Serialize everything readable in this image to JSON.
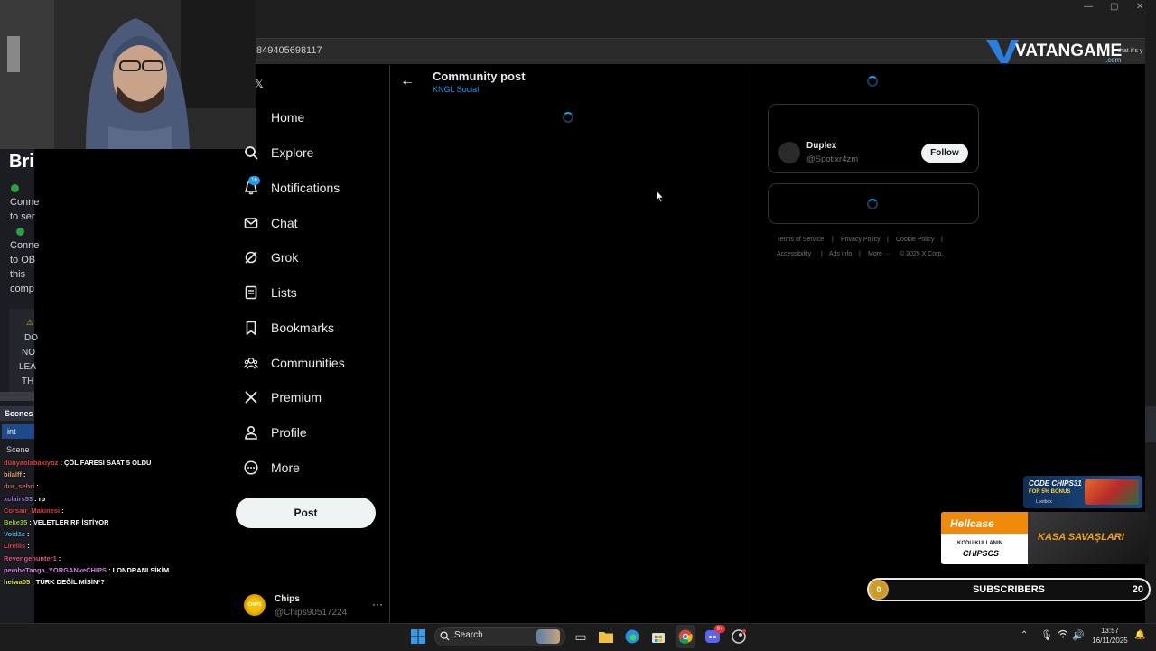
{
  "browser": {
    "address_text": "849405698117"
  },
  "overlay": {
    "brand_logo": "VATANGAME",
    "brand_sub": ".com",
    "brand_tail": "that it's y"
  },
  "obs": {
    "title_fragment": "Bri",
    "status_lines": [
      {
        "line1": "Conne",
        "line2": "to ser"
      },
      {
        "line1": "Conne",
        "line2": "to OB",
        "line3": "this",
        "line4": "comp"
      }
    ],
    "warning_lines": [
      "DO",
      "NO",
      "LEA",
      "TH"
    ],
    "scenes_header": "Scenes",
    "scene_selected": "int",
    "scene_label": "Scene"
  },
  "chat": [
    {
      "user": "dünyaolabakiyoz",
      "user_color": "#e04040",
      "msg": ": ÇÖL FARESİ SAAT 5 OLDU"
    },
    {
      "user": "bilalff",
      "user_color": "#d6a36b",
      "msg": ":"
    },
    {
      "user": "dur_sehri",
      "user_color": "#c06060",
      "msg": ":"
    },
    {
      "user": "xclairs53",
      "user_color": "#a070d0",
      "msg": ": rp"
    },
    {
      "user": "Corsair_Makinesi",
      "user_color": "#e04040",
      "msg": ":"
    },
    {
      "user": "Beke35",
      "user_color": "#9acd32",
      "msg": ": VELETLER RP İSTİYOR"
    },
    {
      "user": "Void1s",
      "user_color": "#4ab0e0",
      "msg": ":"
    },
    {
      "user": "Lirellis",
      "user_color": "#e04060",
      "msg": ":"
    },
    {
      "user": "Revengehunter1",
      "user_color": "#e0508a",
      "msg": ":"
    },
    {
      "user": "pembeTanga_YORGANveCHIPS",
      "user_color": "#d080e0",
      "msg": ": LONDRANI SİKİM"
    },
    {
      "user": "heiwa05",
      "user_color": "#e0e050",
      "msg": ": TÜRK DEĞİL MİSİN*?"
    }
  ],
  "sidebar": {
    "items": [
      {
        "label": "Home",
        "icon": "home-icon"
      },
      {
        "label": "Explore",
        "icon": "search-icon"
      },
      {
        "label": "Notifications",
        "icon": "bell-icon",
        "badge": "16"
      },
      {
        "label": "Chat",
        "icon": "mail-icon"
      },
      {
        "label": "Grok",
        "icon": "grok-icon"
      },
      {
        "label": "Lists",
        "icon": "list-icon"
      },
      {
        "label": "Bookmarks",
        "icon": "bookmark-icon"
      },
      {
        "label": "Communities",
        "icon": "people-icon"
      },
      {
        "label": "Premium",
        "icon": "x-logo-icon"
      },
      {
        "label": "Profile",
        "icon": "person-icon"
      },
      {
        "label": "More",
        "icon": "more-circle-icon"
      }
    ],
    "post_label": "Post"
  },
  "account": {
    "avatar_text": "CHIPS",
    "name": "Chips",
    "handle": "@Chips90517224",
    "more": "···"
  },
  "main": {
    "title": "Community post",
    "subtitle": "KNGL Social"
  },
  "right": {
    "who_to_follow": {
      "name": "Duplex",
      "handle": "@Spotixr4zm",
      "follow_label": "Follow"
    },
    "footer": {
      "row1": [
        "Terms of Service",
        "|",
        "Privacy Policy",
        "|",
        "Cookie Policy",
        "|"
      ],
      "row2": [
        "Accessibility",
        "|",
        "Ads info",
        "|",
        "More ···",
        "© 2025 X Corp."
      ]
    }
  },
  "promo": {
    "code_line": "CODE CHIPS31",
    "code_sub": "FOR 5% BONUS",
    "code_brand": "Lootbox",
    "hellcase_logo": "Hellcase",
    "hellcase_line1": "KODU KULLANIN",
    "hellcase_code": "CHIPSCS",
    "hellcase_right": "KASA SAVAŞLARI"
  },
  "subs_bar": {
    "current": "0",
    "label": "SUBSCRIBERS",
    "goal": "20",
    "progress": 0
  },
  "taskbar": {
    "search_label": "Search",
    "time": "13:57",
    "date": "16/11/2025",
    "discord_badge": "9+"
  }
}
